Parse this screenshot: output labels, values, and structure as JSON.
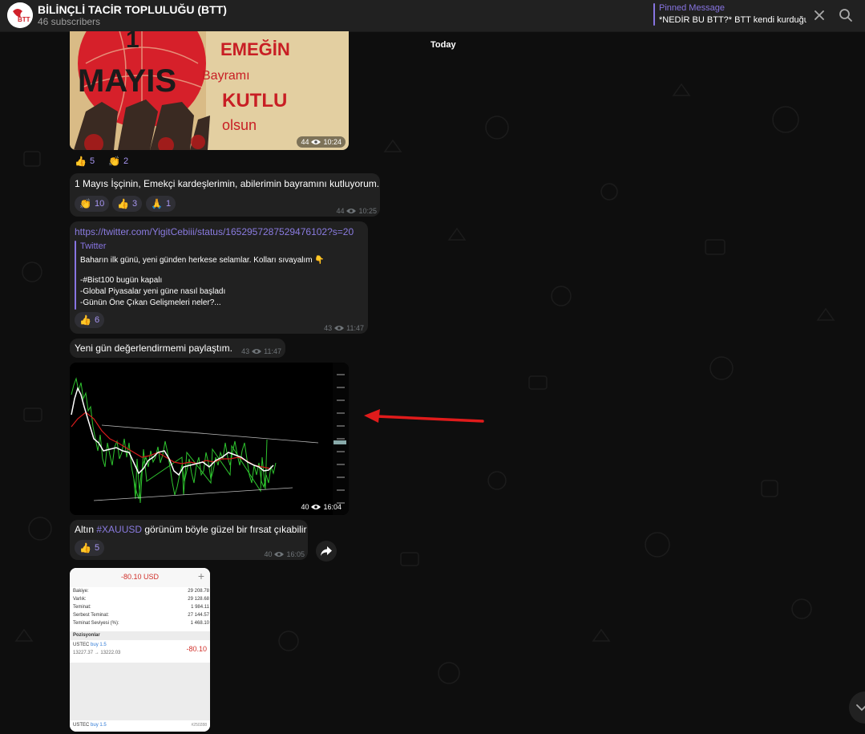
{
  "header": {
    "channel_title": "BİLİNÇLİ TACİR TOPLULUĞU (BTT)",
    "subscribers": "46 subscribers",
    "avatar_text": "BTT",
    "pinned_label": "Pinned Message",
    "pinned_text": "*NEDİR BU BTT?* BTT kendi kurduğu..."
  },
  "date_separator": "Today",
  "messages": [
    {
      "type": "image",
      "poster": {
        "line1": "1",
        "line2": "MAYIS",
        "line3": "EMEĞİN",
        "line4": "Bayramı",
        "line5": "KUTLU",
        "line6": "olsun"
      },
      "views": "44",
      "time": "10:24",
      "reactions": [
        {
          "emoji": "👍",
          "count": "5"
        },
        {
          "emoji": "👏",
          "count": "2"
        }
      ]
    },
    {
      "type": "text",
      "text": "1 Mayıs İşçinin, Emekçi kardeşlerimin, abilerimin bayramını kutluyorum.",
      "views": "44",
      "time": "10:25",
      "reactions": [
        {
          "emoji": "👏",
          "count": "10"
        },
        {
          "emoji": "👍",
          "count": "3"
        },
        {
          "emoji": "🙏",
          "count": "1"
        }
      ]
    },
    {
      "type": "link",
      "url": "https://twitter.com/YigitCebiii/status/1652957287529476102?s=20",
      "preview_site": "Twitter",
      "preview_lines": [
        "Baharın ilk günü, yeni günden herkese selamlar. Kolları sıvayalım 👇",
        "-#Bist100 bugün kapalı",
        "-Global Piyasalar yeni güne nasıl başladı",
        "-Günün Öne Çıkan Gelişmeleri neler?..."
      ],
      "views": "43",
      "time": "11:47",
      "reactions": [
        {
          "emoji": "👍",
          "count": "6"
        }
      ]
    },
    {
      "type": "text",
      "text": "Yeni gün değerlendirmemi paylaştım.",
      "views": "43",
      "time": "11:47"
    },
    {
      "type": "chart_image",
      "views": "40",
      "time": "16:04"
    },
    {
      "type": "text",
      "text_before": "Altın ",
      "hashtag": "#XAUUSD",
      "text_after": " görünüm böyle güzel bir fırsat çıkabilir",
      "views": "40",
      "time": "16:05",
      "reactions": [
        {
          "emoji": "👍",
          "count": "5"
        }
      ]
    },
    {
      "type": "screenshot",
      "amount": "-80.10 USD",
      "rows": [
        {
          "label": "Bakiye:",
          "value": "29 208.78"
        },
        {
          "label": "Varlık:",
          "value": "29 128.68"
        },
        {
          "label": "Teminat:",
          "value": "1 984.11"
        },
        {
          "label": "Serbest Teminat:",
          "value": "27 144.57"
        },
        {
          "label": "Teminat Seviyesi (%):",
          "value": "1 468.10"
        }
      ],
      "positions_label": "Pozisyonlar",
      "position": {
        "symbol": "USTEC",
        "side": "buy 1.5",
        "prices": "13227.37 → 13222.03",
        "pnl": "-80.10"
      },
      "footer": {
        "symbol": "USTEC",
        "side": "buy 1.5",
        "id": "#250288"
      }
    }
  ],
  "colors": {
    "accent": "#8774e1",
    "bubble": "#212121",
    "background": "#0e0e0e",
    "arrow": "#e01b1b"
  }
}
